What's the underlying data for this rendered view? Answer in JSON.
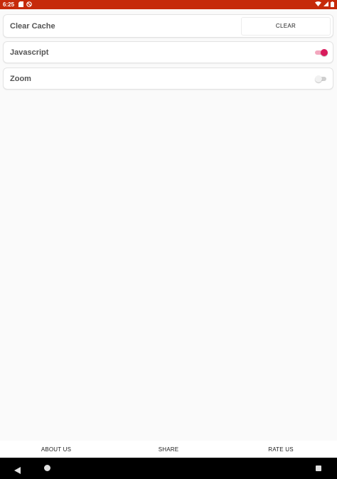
{
  "status_bar": {
    "time": "6:25",
    "icons": [
      "sd-card-icon",
      "no-sync-icon",
      "wifi-icon",
      "signal-icon",
      "battery-icon"
    ],
    "color": "#c62a0a"
  },
  "settings": {
    "clear_cache": {
      "label": "Clear Cache",
      "button_label": "CLEAR"
    },
    "javascript": {
      "label": "Javascript",
      "enabled": true
    },
    "zoom": {
      "label": "Zoom",
      "enabled": false
    }
  },
  "bottom_bar": {
    "about": "ABOUT US",
    "share": "SHARE",
    "rate": "RATE US"
  },
  "colors": {
    "accent": "#d81b5c",
    "status_bar": "#c62a0a"
  }
}
